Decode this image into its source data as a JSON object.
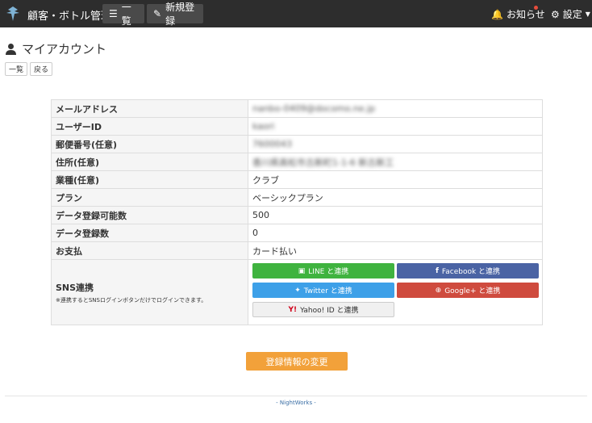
{
  "navbar": {
    "brand": "顧客・ボトル管理",
    "list_label": "一覧",
    "new_label": "新規登録",
    "notice_label": "お知らせ",
    "settings_label": "設定"
  },
  "page": {
    "title": "マイアカウント",
    "btn_list": "一覧",
    "btn_back": "戻る"
  },
  "account": {
    "rows": [
      {
        "label": "メールアドレス",
        "value": "nanbo-0409@docomo.ne.jp"
      },
      {
        "label": "ユーザーID",
        "value": "kaori"
      },
      {
        "label": "郵便番号(任意)",
        "value": "7600043"
      },
      {
        "label": "住所(任意)",
        "value": "香川県高松市古新町1-1-6 新古新工"
      },
      {
        "label": "業種(任意)",
        "value": "クラブ"
      },
      {
        "label": "プラン",
        "value": "ベーシックプラン"
      },
      {
        "label": "データ登録可能数",
        "value": "500"
      },
      {
        "label": "データ登録数",
        "value": "0"
      },
      {
        "label": "お支払",
        "value": "カード払い"
      }
    ],
    "sns_title": "SNS連携",
    "sns_note": "※連携するとSNSログインボタンだけでログインできます。",
    "sns_line": "LINE と連携",
    "sns_facebook": "Facebook と連携",
    "sns_twitter": "Twitter と連携",
    "sns_google": "Google+ と連携",
    "sns_yahoo": "Yahoo! ID と連携"
  },
  "submit_label": "登録情報の変更",
  "footer": "- NightWorks -"
}
